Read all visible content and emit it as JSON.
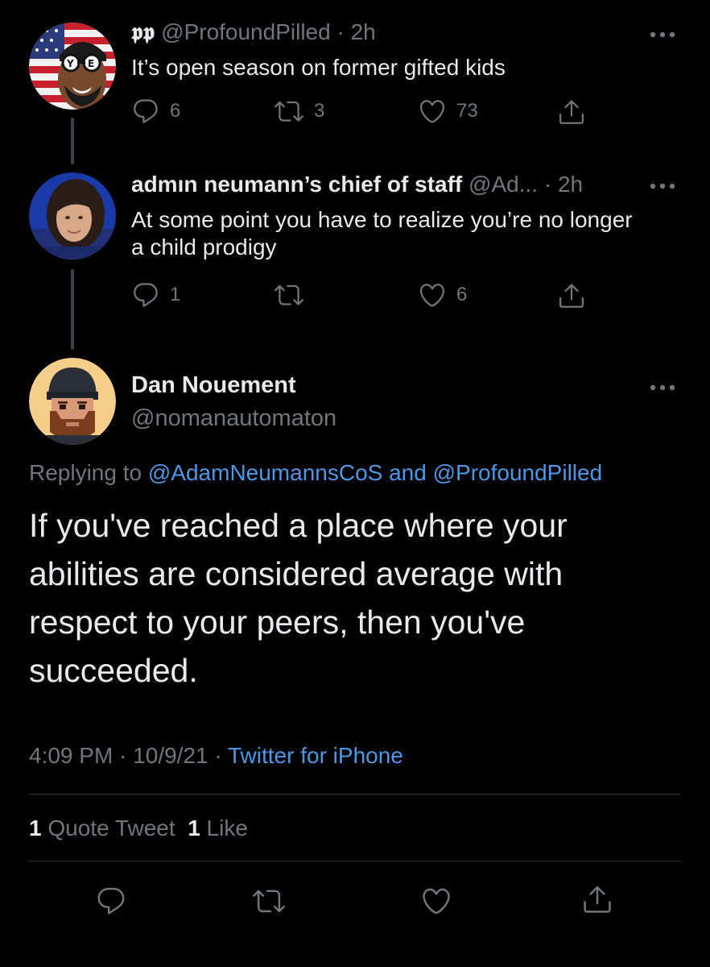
{
  "colors": {
    "background": "#000000",
    "text_primary": "#e7e9ea",
    "text_muted": "#71767b",
    "link": "#4a99e9",
    "divider": "#2f3336"
  },
  "tweet1": {
    "display_name": "𝖕𝖕",
    "handle": "@ProfoundPilled",
    "time": "2h",
    "text": "It’s open season on former gifted kids",
    "replies": "6",
    "retweets": "3",
    "likes": "73"
  },
  "tweet2": {
    "display_name": "admın neumann’s chief of staff",
    "handle": "@Ad...",
    "time": "2h",
    "text": "At some point you have to realize you’re no longer a child prodigy",
    "replies": "1",
    "retweets": "",
    "likes": "6"
  },
  "main_tweet": {
    "display_name": "Dan Nouement",
    "handle": "@nomanautomaton",
    "replying_prefix": "Replying to",
    "reply_to_1": "@AdamNeumannsCoS",
    "reply_and": "and",
    "reply_to_2": "@ProfoundPilled",
    "text": "If you've reached a place where your abilities are considered average with respect to your peers, then you've succeeded.",
    "time": "4:09 PM",
    "date": "10/9/21",
    "source": "Twitter for iPhone",
    "quote_count": "1",
    "quote_label": "Quote Tweet",
    "like_count": "1",
    "like_label": "Like"
  },
  "icons": {
    "reply": "reply-icon",
    "retweet": "retweet-icon",
    "like": "heart-icon",
    "share": "share-icon",
    "more": "more-icon"
  }
}
